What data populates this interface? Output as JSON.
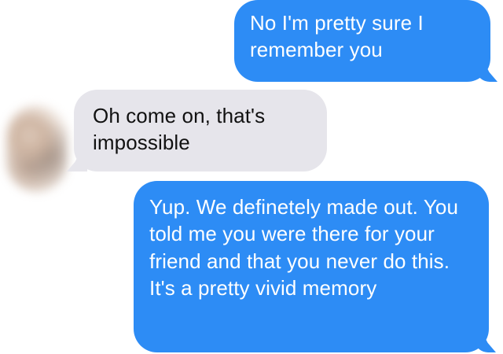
{
  "conversation": {
    "messages": [
      {
        "sender": "me",
        "text": "No I'm pretty sure I remember you"
      },
      {
        "sender": "them",
        "text": "Oh come on, that's impossible"
      },
      {
        "sender": "me",
        "text": "Yup. We definetely made out. You told me you were there for your friend and that you never do this. It's a pretty vivid memory"
      }
    ]
  },
  "colors": {
    "sent_bubble": "#2d8cf5",
    "received_bubble": "#e6e5eb",
    "sent_text": "#ffffff",
    "received_text": "#111111"
  },
  "icons": {
    "contact_avatar": "blurred-contact-photo"
  }
}
